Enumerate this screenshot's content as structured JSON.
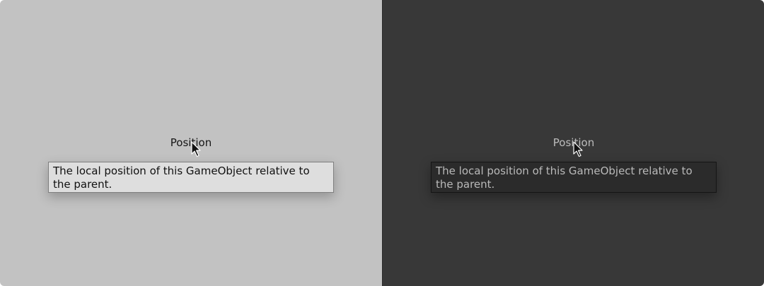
{
  "themes": [
    {
      "id": "light",
      "label": "Position",
      "tooltip": "The local position of this GameObject relative to the parent.",
      "colors": {
        "background": "#c2c2c2",
        "tooltip_bg": "#dedede",
        "text": "#161616"
      }
    },
    {
      "id": "dark",
      "label": "Position",
      "tooltip": "The local position of this GameObject relative to the parent.",
      "colors": {
        "background": "#383838",
        "tooltip_bg": "#2b2b2b",
        "text": "#bcbcbc"
      }
    }
  ],
  "icons": {
    "cursor": "arrow-cursor-icon"
  }
}
